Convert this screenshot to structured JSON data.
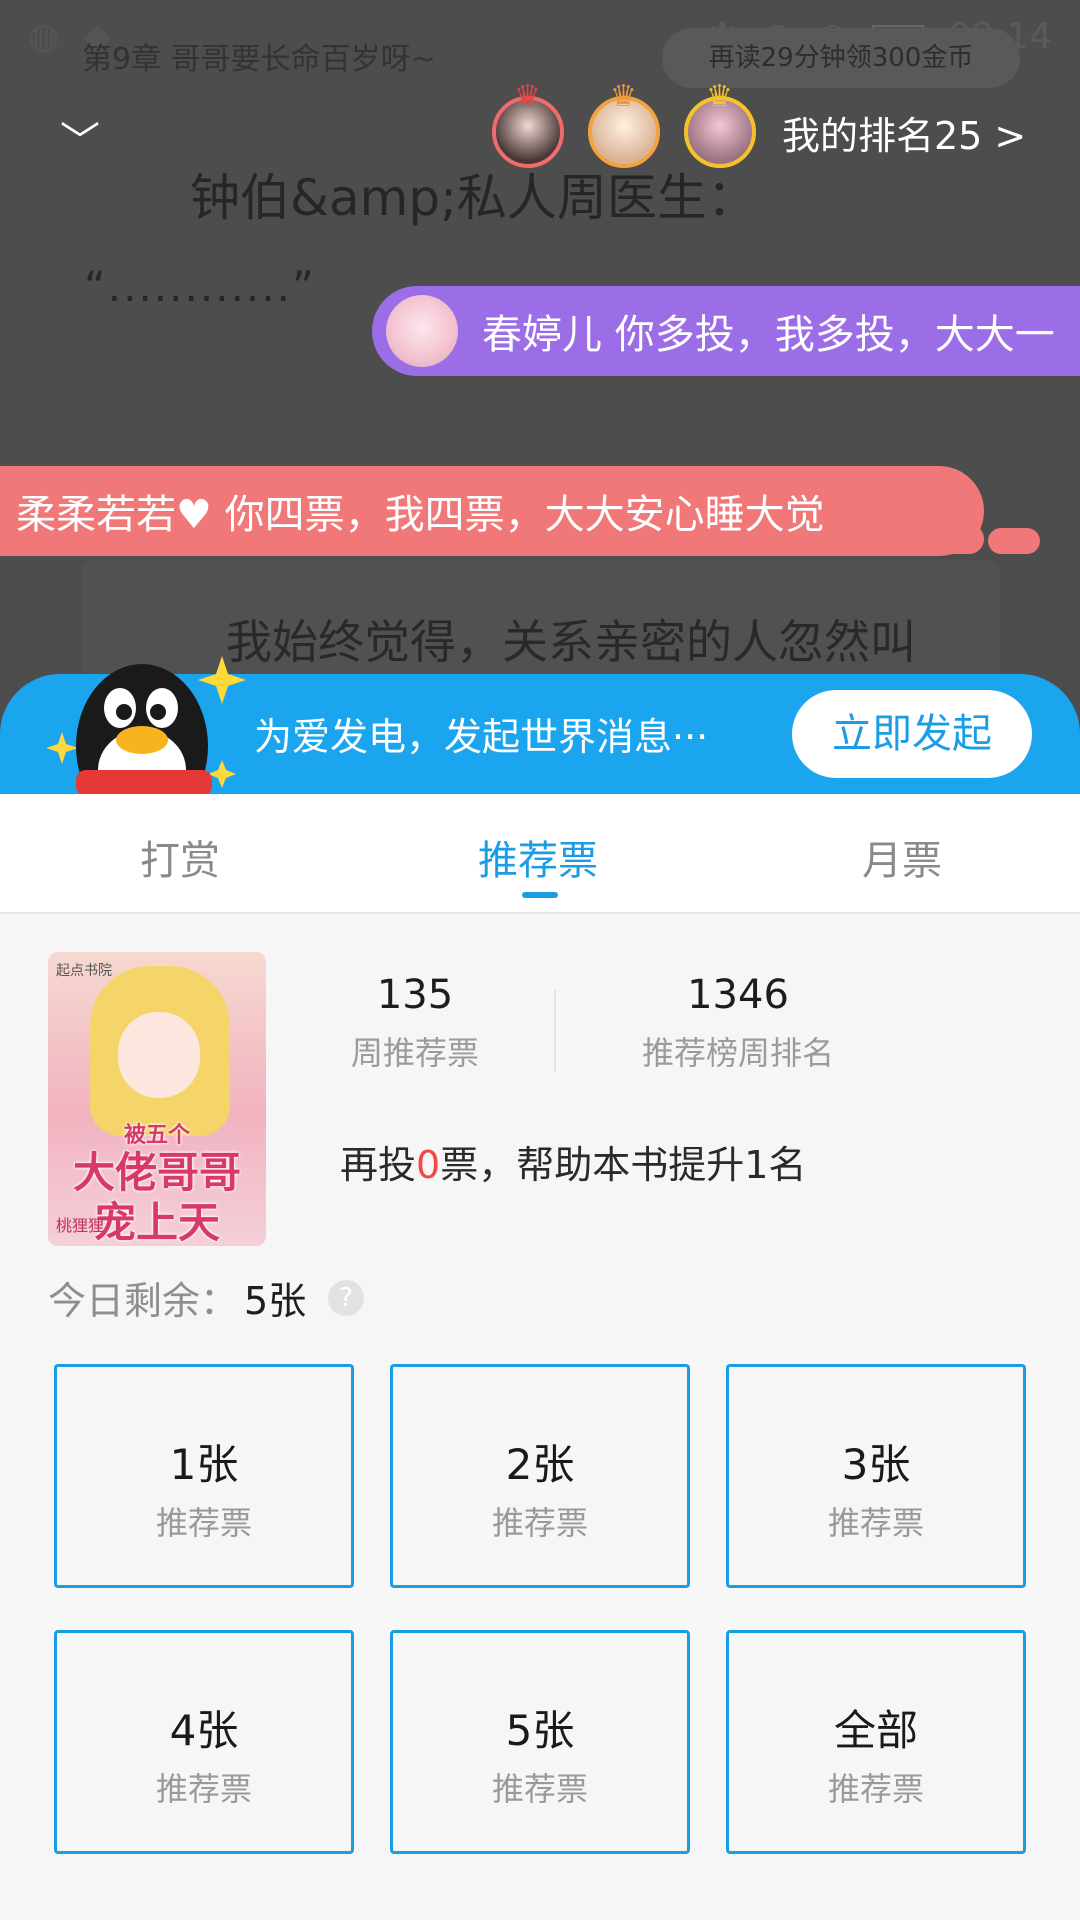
{
  "status_bar": {
    "time": "09:14"
  },
  "reader": {
    "chapter_title": "第9章 哥哥要长命百岁呀~",
    "coin_tip": "再读29分钟领300金币",
    "speaker_line": "钟伯&amp;私人周医生：",
    "quote_line": "“............”",
    "body_line": "我始终觉得，关系亲密的人忽然叫"
  },
  "ranking": {
    "my_rank": "我的排名25 >"
  },
  "danmaku": [
    {
      "text": "春婷儿 你多投，我多投，大大一"
    },
    {
      "text": "柔柔若若♥ 你四票，我四票，大大安心睡大觉"
    }
  ],
  "promo": {
    "text": "为爱发电，发起世界消息···",
    "button": "立即发起"
  },
  "tabs": [
    {
      "label": "打赏"
    },
    {
      "label": "推荐票"
    },
    {
      "label": "月票"
    }
  ],
  "book": {
    "cover_publisher": "起点书院",
    "cover_small": "被五个",
    "cover_title_line1": "大佬哥哥",
    "cover_title_line2": "宠上天",
    "cover_author": "桃狸狸"
  },
  "stats": {
    "weekly_votes": "135",
    "weekly_votes_label": "周推荐票",
    "weekly_rank": "1346",
    "weekly_rank_label": "推荐榜周排名"
  },
  "boost": {
    "prefix": "再投",
    "count": "0",
    "suffix": "票，帮助本书提升1名"
  },
  "remaining": {
    "label": "今日剩余：",
    "count": "5张"
  },
  "tickets": [
    {
      "qty": "1张",
      "label": "推荐票"
    },
    {
      "qty": "2张",
      "label": "推荐票"
    },
    {
      "qty": "3张",
      "label": "推荐票"
    },
    {
      "qty": "4张",
      "label": "推荐票"
    },
    {
      "qty": "5张",
      "label": "推荐票"
    },
    {
      "qty": "全部",
      "label": "推荐票"
    }
  ],
  "colors": {
    "accent": "#1b9de6",
    "danmaku_purple": "#9b6ee8",
    "danmaku_pink": "#f07878",
    "highlight": "#f24848"
  },
  "icons": [
    "chevron-down-icon",
    "help-icon",
    "crown-icon",
    "penguin-mascot-icon",
    "wifi-icon",
    "bluetooth-icon",
    "alarm-icon",
    "battery-icon"
  ]
}
